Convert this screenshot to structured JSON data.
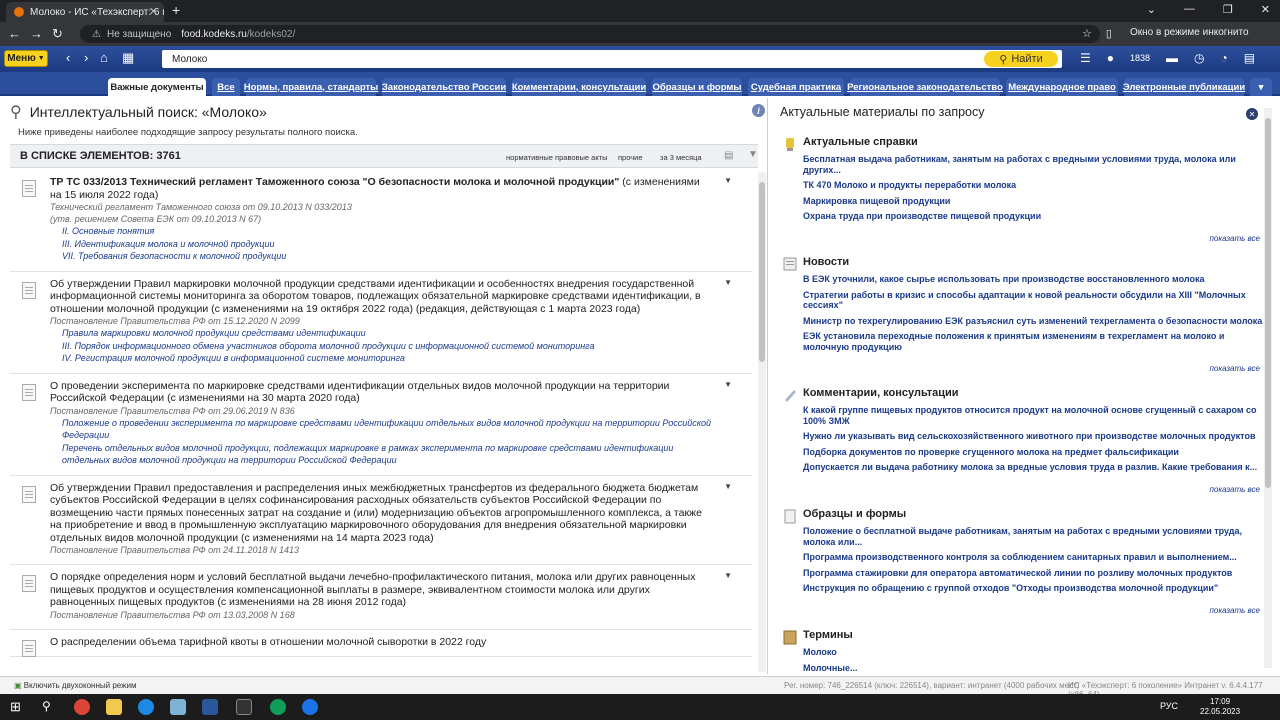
{
  "browser": {
    "tab_title": "Молоко - ИС «Техэксперт: 6 по…",
    "tab_close": "✕",
    "new_tab": "+",
    "window_controls": [
      "⌄",
      "—",
      "❐",
      "✕"
    ],
    "security_label": "Не защищено",
    "url_host": "food.kodeks.ru",
    "url_path": "/kodeks02/",
    "incognito_label": "Окно в режиме инкогнито"
  },
  "toolbar": {
    "menu_label": "Меню",
    "search_value": "Молоко",
    "find_label": "Найти",
    "user_count": "1838"
  },
  "category_tabs": [
    {
      "label": "Важные документы",
      "active": true
    },
    {
      "label": "Все"
    },
    {
      "label": "Нормы, правила, стандарты"
    },
    {
      "label": "Законодательство России"
    },
    {
      "label": "Комментарии, консультации"
    },
    {
      "label": "Образцы и формы"
    },
    {
      "label": "Судебная практика"
    },
    {
      "label": "Региональное законодательство"
    },
    {
      "label": "Международное право"
    },
    {
      "label": "Электронные публикации"
    }
  ],
  "left": {
    "title": "Интеллектуальный поиск: «Молоко»",
    "subtitle": "Ниже приведены наиболее подходящие запросу результаты полного поиска.",
    "count_label": "В СПИСКЕ ЭЛЕМЕНТОВ: 3761",
    "filters": [
      "нормативные правовые акты",
      "прочие",
      "за 3 месяца"
    ],
    "results": [
      {
        "title_bold": "ТР ТС 033/2013 Технический регламент Таможенного союза \"О безопасности молока и молочной продукции\"",
        "title_rest": " (с изменениями на 15 июля 2022 года)",
        "meta": [
          "Технический регламент Таможенного союза от 09.10.2013 N 033/2013",
          "(утв. решением Совета ЕЭК от 09.10.2013 N 67)"
        ],
        "links": [
          "II. Основные понятия",
          "III. Идентификация молока и молочной продукции",
          "VII. Требования безопасности к молочной продукции"
        ]
      },
      {
        "title_bold": "",
        "title_rest": "Об утверждении Правил маркировки молочной продукции средствами идентификации и особенностях внедрения государственной информационной системы мониторинга за оборотом товаров, подлежащих обязательной маркировке средствами идентификации, в отношении молочной продукции (с изменениями на 19 октября 2022 года) (редакция, действующая с 1 марта 2023 года)",
        "meta": [
          "Постановление Правительства РФ от 15.12.2020 N 2099"
        ],
        "links": [
          "Правила маркировки молочной продукции средствами идентификации",
          "III. Порядок информационного обмена участников оборота молочной продукции с информационной системой мониторинга",
          "IV. Регистрация молочной продукции в информационной системе мониторинга"
        ]
      },
      {
        "title_bold": "",
        "title_rest": "О проведении эксперимента по маркировке средствами идентификации отдельных видов молочной продукции на территории Российской Федерации (с изменениями на 30 марта 2020 года)",
        "meta": [
          "Постановление Правительства РФ от 29.06.2019 N 836"
        ],
        "links": [
          "Положение о проведении эксперимента по маркировке средствами идентификации отдельных видов молочной продукции на территории Российской Федерации",
          "Перечень отдельных видов молочной продукции, подлежащих маркировке в рамках эксперимента по маркировке средствами идентификации отдельных видов молочной продукции на территории Российской Федерации"
        ]
      },
      {
        "title_bold": "",
        "title_rest": "Об утверждении Правил предоставления и распределения иных межбюджетных трансфертов из федерального бюджета бюджетам субъектов Российской Федерации в целях софинансирования расходных обязательств субъектов Российской Федерации по возмещению части прямых понесенных затрат на создание и (или) модернизацию объектов агропромышленного комплекса, а также на приобретение и ввод в промышленную эксплуатацию маркировочного оборудования для внедрения обязательной маркировки отдельных видов молочной продукции (с изменениями на 14 марта 2023 года)",
        "meta": [
          "Постановление Правительства РФ от 24.11.2018 N 1413"
        ],
        "links": []
      },
      {
        "title_bold": "",
        "title_rest": "О порядке определения норм и условий бесплатной выдачи лечебно-профилактического питания, молока или других равноценных пищевых продуктов и осуществления компенсационной выплаты в размере, эквивалентном стоимости молока или других равноценных пищевых продуктов (с изменениями на 28 июня 2012 года)",
        "meta": [
          "Постановление Правительства РФ от 13.03.2008 N 168"
        ],
        "links": []
      },
      {
        "title_bold": "",
        "title_rest": "О распределении объема тарифной квоты в отношении молочной сыворотки в 2022 году",
        "meta": [],
        "links": []
      }
    ]
  },
  "right": {
    "title": "Актуальные материалы по запросу",
    "show_all": "показать все",
    "sections": [
      {
        "head": "Актуальные справки",
        "items": [
          "Бесплатная выдача работникам, занятым на работах с вредными условиями труда, молока или других...",
          "ТК 470 Молоко и продукты переработки молока",
          "Маркировка пищевой продукции",
          "Охрана труда при производстве пищевой продукции"
        ]
      },
      {
        "head": "Новости",
        "items": [
          "В ЕЭК уточнили, какое сырье использовать при производстве восстановленного молока",
          "Стратегии работы в кризис и способы адаптации к новой реальности обсудили на XIII \"Молочных сессиях\"",
          "Министр по техрегулированию ЕЭК разъяснил суть изменений техрегламента о безопасности молока",
          "ЕЭК установила переходные положения к принятым изменениям в техрегламент на молоко и молочную продукцию"
        ]
      },
      {
        "head": "Комментарии, консультации",
        "items": [
          "К какой группе пищевых продуктов относится продукт на молочной основе сгущенный с сахаром со 100% ЗМЖ",
          "Нужно ли указывать вид сельскохозяйственного животного при производстве молочных продуктов",
          "Подборка документов по проверке сгущенного молока на предмет фальсификации",
          "Допускается ли выдача работнику молока за вредные условия труда в разлив. Какие требования к..."
        ]
      },
      {
        "head": "Образцы и формы",
        "items": [
          "Положение о бесплатной выдаче работникам, занятым на работах с вредными условиями труда, молока или...",
          "Программа производственного контроля за соблюдением санитарных правил и выполнением...",
          "Программа стажировки для оператора автоматической линии по розливу молочных продуктов",
          "Инструкция по обращению с группой отходов \"Отходы производства молочной продукции\""
        ]
      },
      {
        "head": "Термины",
        "items": [
          "Молоко",
          "Молочные..."
        ]
      }
    ]
  },
  "status": {
    "dual_mode": "Включить двухоконный режим",
    "reg": "Рег. номер: 746_226514 (ключ: 226514), вариант: интранет (4000 рабочих мест)",
    "version": "ИС «Техэксперт: 6 поколение» Интранет v. 6.4.4.177 (x86_64)"
  },
  "taskbar": {
    "lang": "РУС",
    "time": "17:09",
    "date": "22.05.2023"
  }
}
